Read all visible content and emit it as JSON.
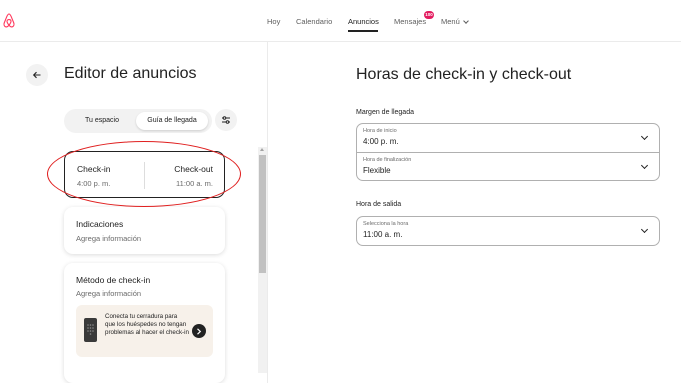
{
  "colors": {
    "brand": "#ff385c",
    "badge": "#e31c5f",
    "annotation": "#e02020"
  },
  "nav": {
    "items": [
      "Hoy",
      "Calendario",
      "Anuncios",
      "Mensajes",
      "Menú"
    ],
    "active": "Anuncios",
    "messages_badge": "100"
  },
  "sidebar": {
    "title": "Editor de anuncios",
    "tabs": [
      "Tu espacio",
      "Guía de llegada"
    ],
    "selected_tab": "Guía de llegada",
    "checkin_card": {
      "checkin_label": "Check-in",
      "checkin_value": "4:00 p. m.",
      "checkout_label": "Check-out",
      "checkout_value": "11:00 a. m."
    },
    "indications_card": {
      "title": "Indicaciones",
      "subtitle": "Agrega información"
    },
    "method_card": {
      "title": "Método de check-in",
      "subtitle": "Agrega información",
      "promo_text": "Conecta tu cerradura para que los huéspedes no tengan problemas al hacer el check-in"
    }
  },
  "main": {
    "title": "Horas de check-in y check-out",
    "arrival_window": {
      "label": "Margen de llegada",
      "start_label": "Hora de inicio",
      "start_value": "4:00 p. m.",
      "end_label": "Hora de finalización",
      "end_value": "Flexible"
    },
    "checkout": {
      "label": "Hora de salida",
      "field_label": "Selecciona la hora",
      "field_value": "11:00 a. m."
    }
  }
}
